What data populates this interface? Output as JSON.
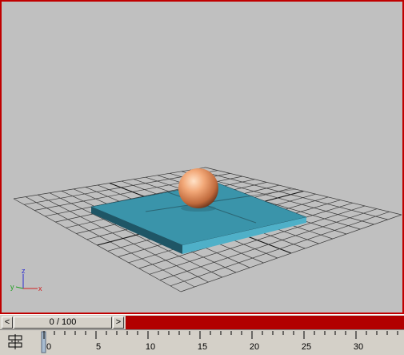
{
  "viewport": {
    "label": "",
    "accent_color": "#c00000",
    "background_color": "#c0c0c0",
    "objects": [
      {
        "name": "sphere",
        "color": "#e09060"
      },
      {
        "name": "box",
        "color": "#3a94aa"
      }
    ],
    "axis_labels": {
      "x": "x",
      "y": "y",
      "z": "z"
    }
  },
  "time_slider": {
    "prev_label": "<",
    "frame_text": "0 / 100",
    "next_label": ">"
  },
  "timeline": {
    "ticks": [
      "0",
      "5",
      "10",
      "15",
      "20",
      "25",
      "30"
    ],
    "track_bar_icon": "track-bar-toggle-icon"
  }
}
